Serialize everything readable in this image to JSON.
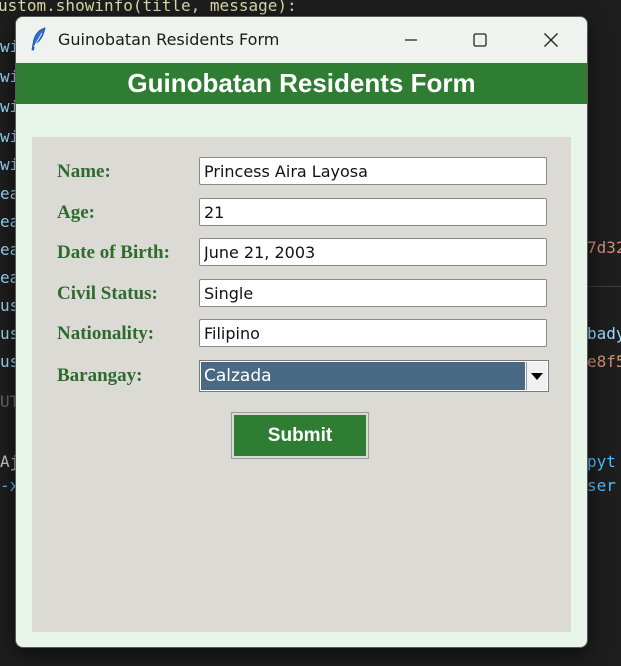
{
  "background_code": {
    "line_top": "ustom.showinfo(title, message):",
    "left_fragments": [
      "wi",
      "wi",
      "wi",
      "wi",
      "wi",
      "ea",
      "ea",
      "ea",
      "ea",
      "us",
      "us",
      "us",
      "UT",
      "",
      "Aj",
      "-x"
    ],
    "right_fragments": [
      "7d32",
      "bady",
      "e8f5",
      "pyt",
      "ser"
    ]
  },
  "window": {
    "title": "Guinobatan Residents Form",
    "icon": "feather-icon",
    "controls": {
      "minimize": "minimize-icon",
      "maximize": "maximize-icon",
      "close": "close-icon"
    }
  },
  "header": {
    "title": "Guinobatan Residents Form",
    "color": "#2e7d32"
  },
  "form": {
    "fields": [
      {
        "label": "Name:",
        "value": "Princess Aira Layosa"
      },
      {
        "label": "Age:",
        "value": "21"
      },
      {
        "label": "Date of Birth:",
        "value": "June 21, 2003"
      },
      {
        "label": "Civil Status:",
        "value": "Single"
      },
      {
        "label": "Nationality:",
        "value": "Filipino"
      }
    ],
    "barangay": {
      "label": "Barangay:",
      "selected": "Calzada"
    },
    "submit_label": "Submit"
  },
  "colors": {
    "accent": "#2e7d32",
    "label_text": "#2e6b2f",
    "window_bg": "#e8f5e9",
    "panel_bg": "#dcdad5",
    "selection": "#4a6984"
  }
}
